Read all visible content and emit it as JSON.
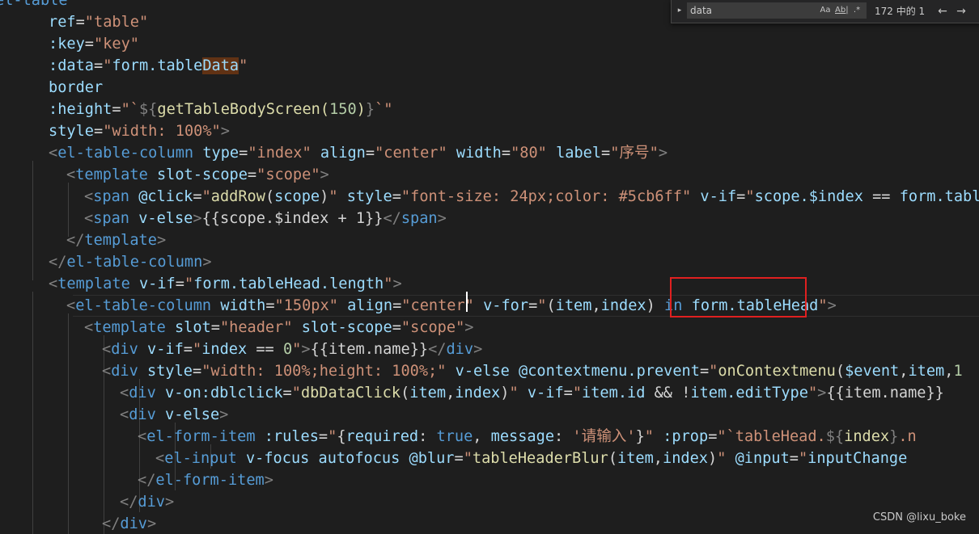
{
  "find": {
    "query": "data",
    "match_case_icon": "Aa",
    "whole_word_icon": "Ab|",
    "regex_icon": ".*",
    "match_count": "172 中的 1",
    "prev_icon": "←",
    "next_icon": "→",
    "toggle_icon": "▸"
  },
  "code_lines": [
    "el-table",
    "  ref=\"table\"",
    "  :key=\"key\"",
    "  :data=\"form.tableData\"",
    "  border",
    "  :height=\"`${getTableBodyScreen(150)}`\"",
    "  style=\"width: 100%\">",
    "  <el-table-column type=\"index\" align=\"center\" width=\"80\" label=\"序号\">",
    "    <template slot-scope=\"scope\">",
    "      <span @click=\"addRow(scope)\" style=\"font-size: 24px;color: #5cb6ff\" v-if=\"scope.$index == form.table",
    "      <span v-else>{{scope.$index + 1}}</span>",
    "    </template>",
    "  </el-table-column>",
    "  <template v-if=\"form.tableHead.length\">",
    "    <el-table-column width=\"150px\" align=\"center\" v-for=\"(item,index) in form.tableHead\">",
    "      <template slot=\"header\" slot-scope=\"scope\">",
    "        <div v-if=\"index == 0\">{{item.name}}</div>",
    "        <div style=\"width: 100%;height: 100%;\" v-else @contextmenu.prevent=\"onContextmenu($event,item,1",
    "          <div v-on:dblclick=\"dbDataClick(item,index)\" v-if=\"item.id && !item.editType\">{{item.name}}",
    "          <div v-else>",
    "            <el-form-item :rules=\"{required: true, message: '请输入'}\" :prop=\"`tableHead.${index}.n",
    "              <el-input v-focus autofocus @blur=\"tableHeaderBlur(item,index)\" @input=\"inputChange",
    "            </el-form-item>",
    "          </div>",
    "        </div>"
  ],
  "watermark": "CSDN @lixu_boke"
}
